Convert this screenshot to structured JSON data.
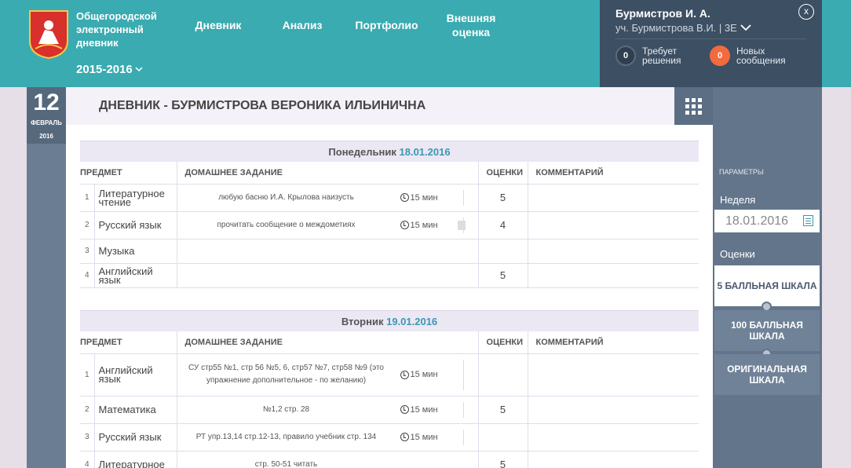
{
  "header": {
    "brand": "Общегородской электронный дневник",
    "year": "2015-2016",
    "nav": [
      "Дневник",
      "Анализ",
      "Портфолио",
      "Внешняя оценка"
    ]
  },
  "user": {
    "name": "Бурмистров И. А.",
    "sub": "уч. Бурмистрова В.И. | 3Е",
    "close": "x",
    "pending_count": "0",
    "pending_label": "Требует решения",
    "messages_count": "0",
    "messages_label": "Новых сообщения"
  },
  "date": {
    "day": "12",
    "month": "ФЕВРАЛЬ",
    "year": "2016"
  },
  "page_title": "ДНЕВНИК - БУРМИСТРОВА ВЕРОНИКА ИЛЬИНИЧНА",
  "columns": {
    "subject": "ПРЕДМЕТ",
    "homework": "ДОМАШНЕЕ ЗАДАНИЕ",
    "grades": "ОЦЕНКИ",
    "comment": "КОММЕНТАРИЙ"
  },
  "days": [
    {
      "weekday": "Понедельник",
      "date": "18.01.2016",
      "rows": [
        {
          "num": "1",
          "subject": "Литературное чтение",
          "homework": "любую басню И.А. Крылова наизусть",
          "time": "15 мин",
          "grade": "5",
          "has_doc": false
        },
        {
          "num": "2",
          "subject": "Русский язык",
          "homework": "прочитать сообщение о междометиях",
          "time": "15 мин",
          "grade": "4",
          "has_doc": true
        },
        {
          "num": "3",
          "subject": "Музыка",
          "homework": "",
          "time": "",
          "grade": "",
          "has_doc": false
        },
        {
          "num": "4",
          "subject": "Английский язык",
          "homework": "",
          "time": "",
          "grade": "5",
          "has_doc": false
        }
      ]
    },
    {
      "weekday": "Вторник",
      "date": "19.01.2016",
      "rows": [
        {
          "num": "1",
          "subject": "Английский язык",
          "homework": "СУ стр55 №1, стр 56 №5, 6, стр57 №7, стр58 №9 (это упражнение дополнительное - по желанию)",
          "time": "15 мин",
          "grade": "",
          "has_doc": false
        },
        {
          "num": "2",
          "subject": "Математика",
          "homework": "№1,2 стр. 28",
          "time": "15 мин",
          "grade": "5",
          "has_doc": false
        },
        {
          "num": "3",
          "subject": "Русский язык",
          "homework": "РТ упр.13,14 стр.12-13, правило учебник стр. 134",
          "time": "15 мин",
          "grade": "",
          "has_doc": false
        },
        {
          "num": "4",
          "subject": "Литературное",
          "homework": "стр. 50-51 читать",
          "time": "",
          "grade": "5",
          "has_doc": false
        }
      ]
    }
  ],
  "params": {
    "title": "ПАРАМЕТРЫ",
    "week_label": "Неделя",
    "week_value": "18.01.2016",
    "grades_label": "Оценки",
    "scales": [
      "5 БАЛЛЬНАЯ ШКАЛА",
      "100 БАЛЛЬНАЯ ШКАЛА",
      "ОРИГИНАЛЬНАЯ ШКАЛА"
    ]
  },
  "colors": {
    "header": "#3aabb0",
    "user_panel": "#3c4f63",
    "accent": "#3a98b5",
    "badge_orange": "#f26a3d"
  }
}
